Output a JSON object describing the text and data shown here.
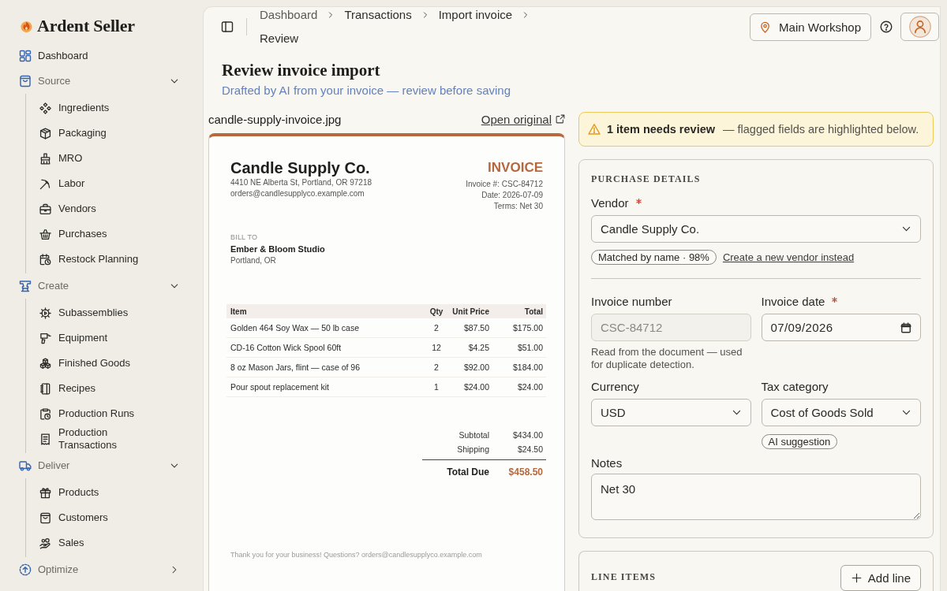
{
  "sidebar": {
    "brand": "Ardent Seller",
    "items": [
      {
        "label": "Dashboard",
        "kind": "link"
      },
      {
        "label": "Source",
        "kind": "section",
        "expanded": true,
        "children": [
          {
            "label": "Ingredients"
          },
          {
            "label": "Packaging"
          },
          {
            "label": "MRO"
          },
          {
            "label": "Labor"
          },
          {
            "label": "Vendors"
          },
          {
            "label": "Purchases"
          },
          {
            "label": "Restock Planning"
          }
        ]
      },
      {
        "label": "Create",
        "kind": "section",
        "expanded": true,
        "children": [
          {
            "label": "Subassemblies"
          },
          {
            "label": "Equipment"
          },
          {
            "label": "Finished Goods"
          },
          {
            "label": "Recipes"
          },
          {
            "label": "Production Runs"
          },
          {
            "label": "Production Transactions"
          }
        ]
      },
      {
        "label": "Deliver",
        "kind": "section",
        "expanded": true,
        "children": [
          {
            "label": "Products"
          },
          {
            "label": "Customers"
          },
          {
            "label": "Sales"
          }
        ]
      },
      {
        "label": "Optimize",
        "kind": "section",
        "expanded": false
      }
    ]
  },
  "header": {
    "breadcrumb": [
      "Dashboard",
      "Transactions",
      "Import invoice",
      "Review"
    ],
    "location": "Main Workshop"
  },
  "page": {
    "title": "Review invoice import",
    "subtitle": "Drafted by AI from your invoice — review before saving"
  },
  "document": {
    "file_name": "candle-supply-invoice.jpg",
    "open_link": "Open original",
    "invoice": {
      "vendor_name": "Candle Supply Co.",
      "vendor_address": "4410 NE Alberta St, Portland, OR 97218",
      "vendor_email": "orders@candlesupplyco.example.com",
      "title": "INVOICE",
      "meta": [
        "Invoice #: CSC-84712",
        "Date: 2026-07-09",
        "Terms: Net 30"
      ],
      "bill_to_label": "BILL TO",
      "bill_to_name": "Ember & Bloom Studio",
      "bill_to_location": "Portland, OR",
      "table": {
        "columns": [
          "Item",
          "Qty",
          "Unit Price",
          "Total"
        ],
        "rows": [
          [
            "Golden 464 Soy Wax — 50 lb case",
            "2",
            "$87.50",
            "$175.00"
          ],
          [
            "CD-16 Cotton Wick Spool 60ft",
            "12",
            "$4.25",
            "$51.00"
          ],
          [
            "8 oz Mason Jars, flint — case of 96",
            "2",
            "$92.00",
            "$184.00"
          ],
          [
            "Pour spout replacement kit",
            "1",
            "$24.00",
            "$24.00"
          ]
        ]
      },
      "totals": [
        {
          "label": "Subtotal",
          "value": "$434.00"
        },
        {
          "label": "Shipping",
          "value": "$24.50"
        }
      ],
      "total_due": {
        "label": "Total Due",
        "value": "$458.50"
      },
      "footer": "Thank you for your business! Questions? orders@candlesupplyco.example.com"
    }
  },
  "review_alert": {
    "headline": "1 item needs review",
    "message": "— flagged fields are highlighted below."
  },
  "purchase_details": {
    "heading": "PURCHASE DETAILS",
    "vendor": {
      "label": "Vendor",
      "required": true,
      "kind": "select",
      "value": "Candle Supply Co.",
      "match_badge": "Matched by name · 98%",
      "create_link": "Create a new vendor instead"
    },
    "field_rows": [
      [
        {
          "label": "Invoice number",
          "required": false,
          "kind": "text",
          "value": "CSC-84712",
          "disabled": true,
          "hint": "Read from the document — used for duplicate detection."
        },
        {
          "label": "Invoice date",
          "required": true,
          "kind": "date",
          "value": "07/09/2026",
          "disabled": false
        }
      ],
      [
        {
          "label": "Currency",
          "required": false,
          "kind": "select",
          "value": "USD",
          "disabled": false
        },
        {
          "label": "Tax category",
          "required": false,
          "kind": "select",
          "value": "Cost of Goods Sold",
          "disabled": false,
          "badge": "AI suggestion"
        }
      ]
    ],
    "notes": {
      "label": "Notes",
      "required": false,
      "kind": "textarea",
      "value": "Net 30"
    }
  },
  "line_items": {
    "heading": "LINE ITEMS",
    "add_button": "Add line"
  }
}
